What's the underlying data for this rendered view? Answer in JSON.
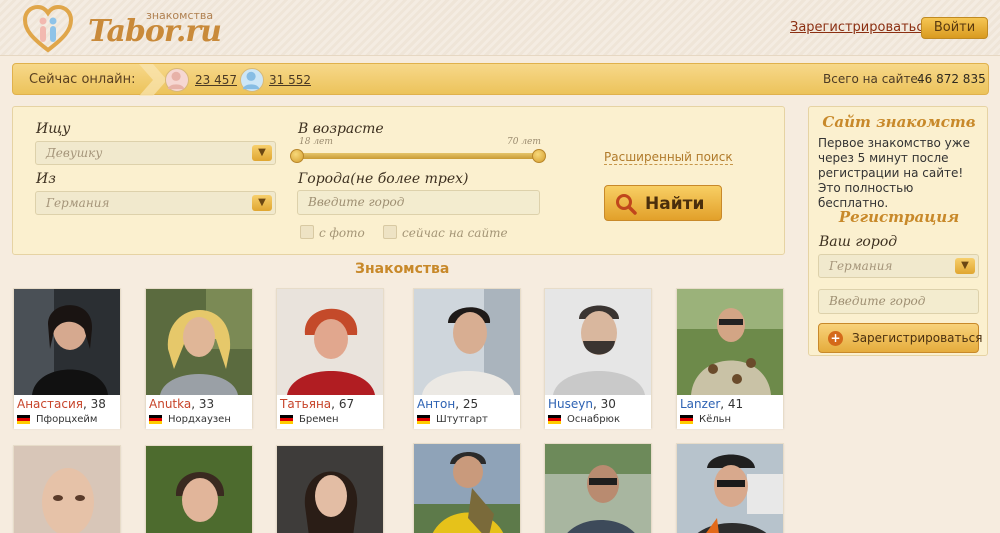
{
  "header": {
    "logo_text": "Tabor.ru",
    "logo_small": "знакомства",
    "register_link": "Зарегистрироваться",
    "login_button": "Войти"
  },
  "online": {
    "label": "Сейчас онлайн:",
    "women_count": "23 457",
    "men_count": "31 552",
    "total_label": "Всего на сайте:",
    "total_value": "46 872 835"
  },
  "search": {
    "seek_label": "Ищу",
    "seek_value": "Девушку",
    "from_label": "Из",
    "from_value": "Германия",
    "age_label": "В возрасте",
    "age_min": "18 лет",
    "age_max": "70 лет",
    "age_min_fraction": 0,
    "age_max_fraction": 1,
    "city_label": "Города(не более трех)",
    "city_placeholder": "Введите город",
    "advanced_link": "Расширенный поиск",
    "find_button": "Найти",
    "with_photo_label": "с фото",
    "online_now_label": "сейчас на сайте"
  },
  "section_title": "Знакомства",
  "cards_row1": [
    {
      "name": "Анастасия",
      "age": "38",
      "city": "Пфорцхейм",
      "gender": "f"
    },
    {
      "name": "Anutka",
      "age": "33",
      "city": "Нордхаузен",
      "gender": "f"
    },
    {
      "name": "Татьяна",
      "age": "67",
      "city": "Бремен",
      "gender": "f"
    },
    {
      "name": "Антон",
      "age": "25",
      "city": "Штутгарт",
      "gender": "m"
    },
    {
      "name": "Huseyn",
      "age": "30",
      "city": "Оснабрюк",
      "gender": "m"
    },
    {
      "name": "Lanzer",
      "age": "41",
      "city": "Кёльн",
      "gender": "m"
    }
  ],
  "right_panel": {
    "title": "Сайт знакомств",
    "text": "Первое знакомство уже через 5 минут после регистрации на сайте! Это полностью бесплатно.",
    "reg_title": "Регистрация",
    "city_label": "Ваш город",
    "country_value": "Германия",
    "city_placeholder": "Введите город",
    "register_button": "Зарегистрироваться"
  },
  "colors": {
    "accent": "#e2a02a",
    "female_name": "#c7442a",
    "male_name": "#2d62b3",
    "link": "#8b2f12"
  }
}
